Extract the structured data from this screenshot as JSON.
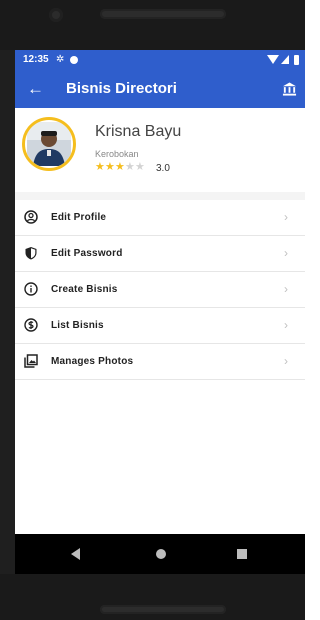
{
  "status_bar": {
    "time": "12:35",
    "icons": [
      "gear-icon",
      "notification-dot-icon",
      "wifi-icon",
      "signal-icon",
      "battery-icon"
    ]
  },
  "app_bar": {
    "title": "Bisnis Directori",
    "left_icon": "back-arrow-icon",
    "right_icon": "bank-icon",
    "background": "#2f5ecc"
  },
  "profile": {
    "name": "Krisna Bayu",
    "location": "Kerobokan",
    "stars_filled": 3,
    "stars_total": 5,
    "rating": "3.0",
    "accent": "#f5be1e"
  },
  "menu": {
    "items": [
      {
        "label": "Edit Profile",
        "icon": "account-circle-icon"
      },
      {
        "label": "Edit Password",
        "icon": "shield-icon"
      },
      {
        "label": "Create Bisnis",
        "icon": "info-icon"
      },
      {
        "label": "List Bisnis",
        "icon": "dollar-circle-icon"
      },
      {
        "label": "Manages Photos",
        "icon": "photo-library-icon"
      }
    ],
    "chevron": "chevron-right-icon"
  },
  "nav_bar": {
    "icons": [
      "nav-back-icon",
      "nav-home-icon",
      "nav-recents-icon"
    ]
  }
}
